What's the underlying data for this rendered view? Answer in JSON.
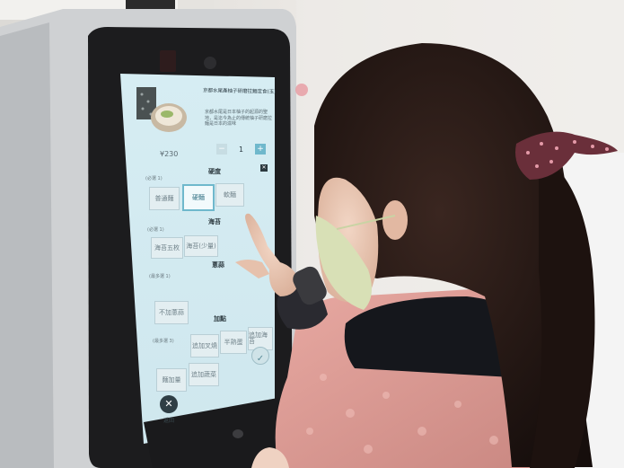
{
  "kiosk": {
    "item_title": "京都水尾產柚子研磨拉麵定食(玉)",
    "item_desc": "京都水尾是日本柚子的起源的聖地，是迄今為止的傳統柚子研磨拉麵是日本的滋味",
    "price": "¥230",
    "quantity": "1",
    "minus_label": "−",
    "plus_label": "+",
    "close_label": "✕",
    "sections": [
      {
        "tag": "(必選 1)",
        "title": "硬度",
        "options": [
          "普通麵",
          "硬麵",
          "軟麵"
        ],
        "selected_index": 1
      },
      {
        "tag": "(必選 1)",
        "title": "海苔",
        "options": [
          "海苔五枚",
          "海苔(少量)"
        ]
      },
      {
        "tag": "(最多選 1)",
        "title": "蔥蒜",
        "options": [
          "不加蔥蒜"
        ]
      },
      {
        "tag": "(最多選 3)",
        "title": "加點",
        "options": [
          "追加叉燒",
          "半熟蛋",
          "追加海苔",
          "麵加量",
          "追加蔬菜"
        ]
      }
    ],
    "cancel_label": "返回",
    "cancel_icon": "close-icon",
    "confirm_icon": "check-icon",
    "colors": {
      "screen": "#dceff4",
      "accent": "#6fb8cc"
    }
  }
}
